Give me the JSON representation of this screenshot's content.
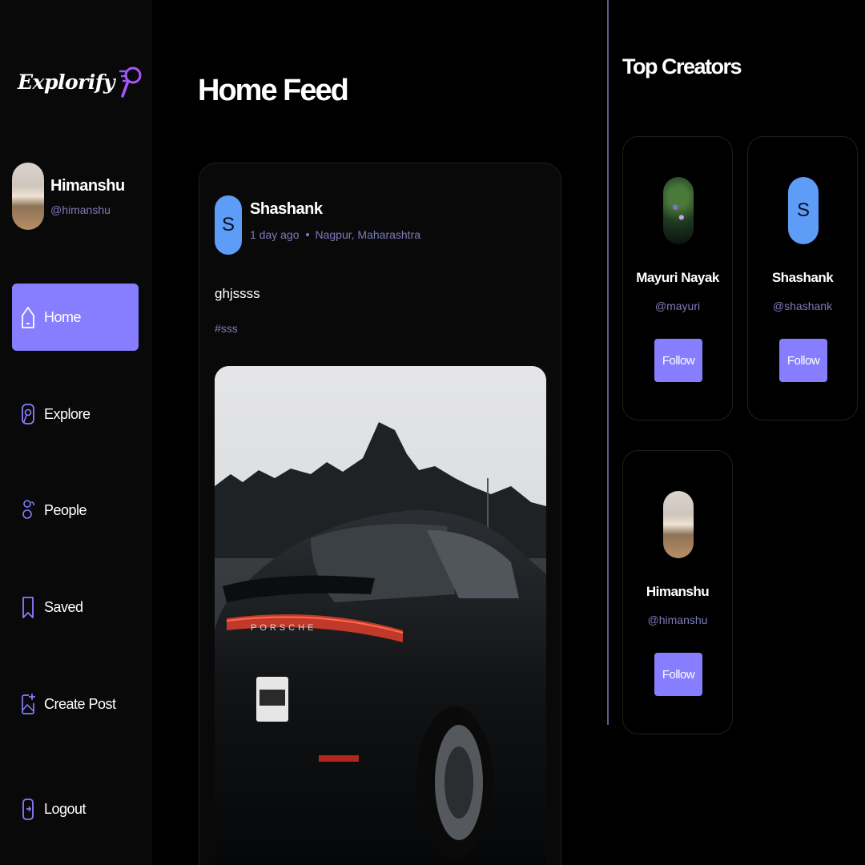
{
  "app": {
    "name": "Explorify"
  },
  "user": {
    "name": "Himanshu",
    "handle": "@himanshu"
  },
  "nav": [
    {
      "label": "Home",
      "icon": "home-icon",
      "active": true
    },
    {
      "label": "Explore",
      "icon": "explore-icon",
      "active": false
    },
    {
      "label": "People",
      "icon": "people-icon",
      "active": false
    },
    {
      "label": "Saved",
      "icon": "bookmark-icon",
      "active": false
    },
    {
      "label": "Create Post",
      "icon": "create-post-icon",
      "active": false
    },
    {
      "label": "Logout",
      "icon": "logout-icon",
      "active": false
    }
  ],
  "feed": {
    "title": "Home Feed",
    "post": {
      "author_initial": "S",
      "author": "Shashank",
      "time": "1 day ago",
      "location": "Nagpur, Maharashtra",
      "caption": "ghjssss",
      "tag": "#sss",
      "image_alt": "car-photo"
    }
  },
  "creators": {
    "title": "Top Creators",
    "items": [
      {
        "name": "Mayuri Nayak",
        "handle": "@mayuri",
        "avatar": "photo",
        "follow_label": "Follow"
      },
      {
        "name": "Shashank",
        "handle": "@shashank",
        "avatar": "letter",
        "initial": "S",
        "follow_label": "Follow"
      },
      {
        "name": "Himanshu",
        "handle": "@himanshu",
        "avatar": "photo",
        "follow_label": "Follow"
      }
    ]
  },
  "colors": {
    "accent": "#877eff",
    "muted": "#7d7bb8",
    "avatar_blue": "#5d9cf7",
    "background": "#000000",
    "sidebar": "#09090a"
  }
}
